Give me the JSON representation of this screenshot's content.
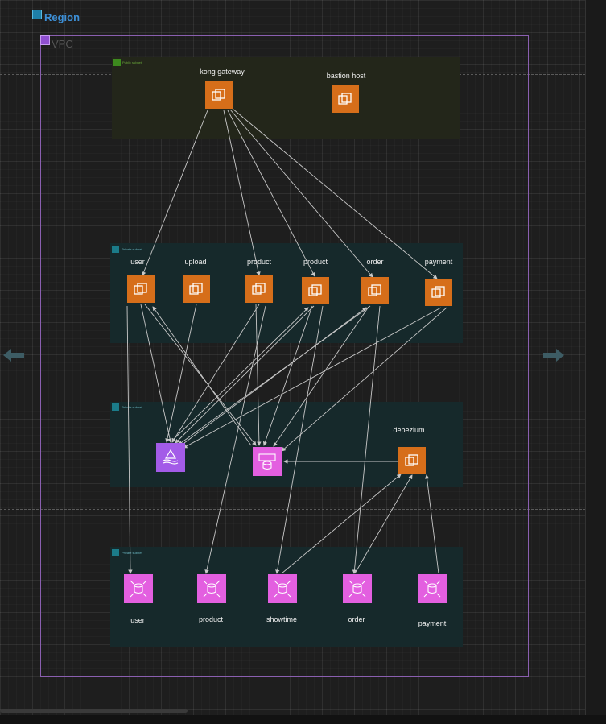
{
  "region": {
    "label": "Region",
    "icon": "region-icon"
  },
  "vpc": {
    "label": "VPC",
    "icon": "vpc-icon"
  },
  "subnets": {
    "public": {
      "label": "Public subnet"
    },
    "private_services": {
      "label": "Private subnet"
    },
    "private_data": {
      "label": "Private subnet"
    },
    "private_db": {
      "label": "Private subnet"
    }
  },
  "public_nodes": {
    "kong": "kong gateway",
    "bastion": "bastion host"
  },
  "services": {
    "user": "user",
    "upload": "upload",
    "product1": "product",
    "product2": "product",
    "order": "order",
    "payment": "payment"
  },
  "data_layer": {
    "debezium": "debezium"
  },
  "databases": {
    "user": "user",
    "product": "product",
    "showtime": "showtime",
    "order": "order",
    "payment": "payment"
  },
  "colors": {
    "ec2": "#d66e1a",
    "database": "#e35fe0",
    "mq": "#a35be8",
    "edge": "#c8c8c8"
  },
  "icons": [
    "ec2-instance-icon",
    "rds-database-icon",
    "mq-broker-icon",
    "arrow-left-icon",
    "arrow-right-icon"
  ]
}
